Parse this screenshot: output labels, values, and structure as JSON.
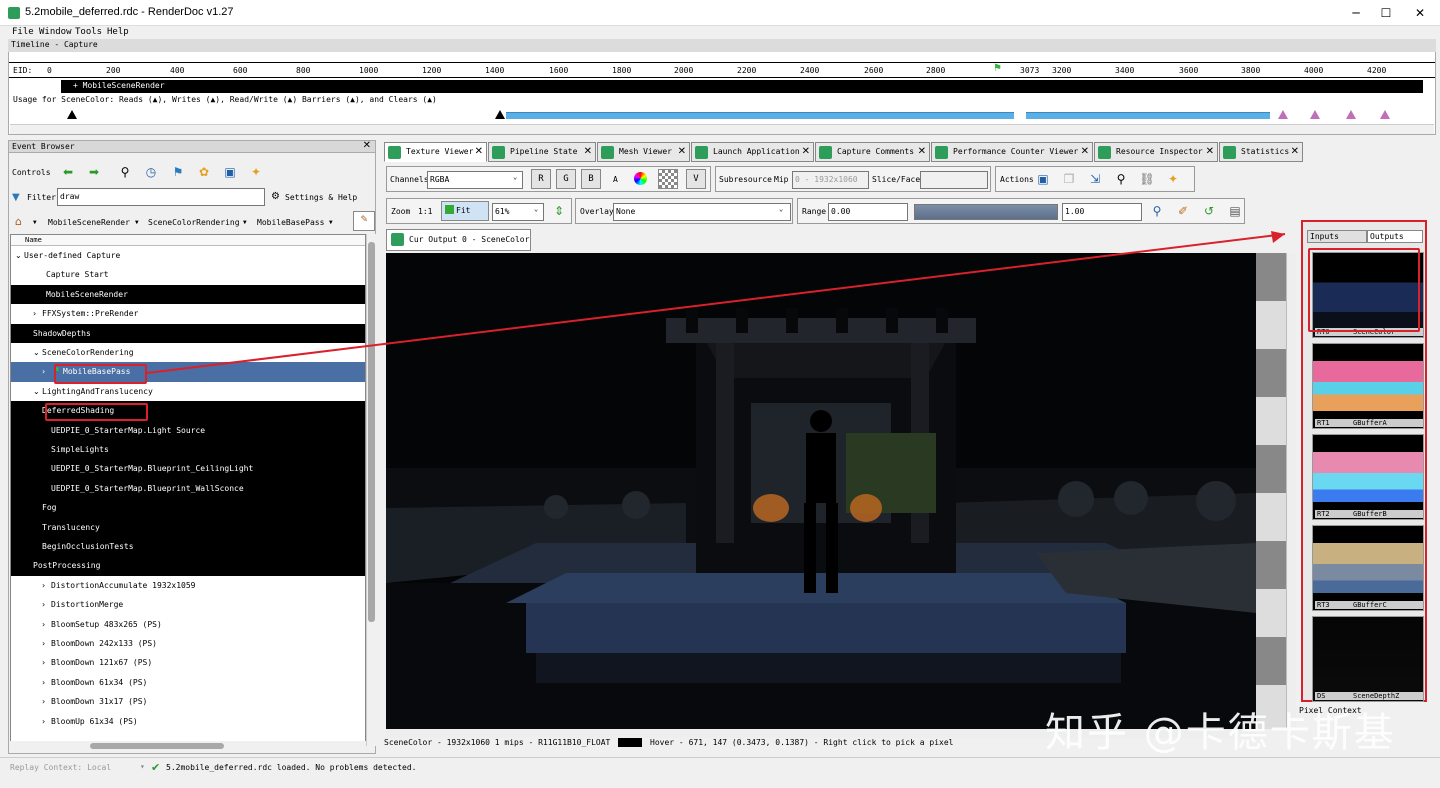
{
  "window": {
    "title": "5.2mobile_deferred.rdc - RenderDoc v1.27",
    "min": "─",
    "max": "☐",
    "close": "✕"
  },
  "menu": [
    "File",
    "Window",
    "Tools",
    "Help"
  ],
  "timeline": {
    "header": "Timeline - Capture",
    "eid_label": "EID:",
    "ticks": [
      "0",
      "200",
      "400",
      "600",
      "800",
      "1000",
      "1200",
      "1400",
      "1600",
      "1800",
      "2000",
      "2200",
      "2400",
      "2600",
      "2800",
      "3073",
      "3200",
      "3400",
      "3600",
      "3800",
      "4000",
      "4200"
    ],
    "marker": "3073",
    "event_label": "+ MobileSceneRender",
    "usage": "Usage for SceneColor: Reads (▲), Writes (▲), Read/Write (▲) Barriers (▲), and Clears (▲)"
  },
  "event_browser": {
    "header": "Event Browser",
    "controls_label": "Controls",
    "filter_label": "Filter",
    "filter_value": "draw",
    "settings_label": "Settings & Help",
    "breadcrumbs": [
      "MobileSceneRender",
      "SceneColorRendering",
      "MobileBasePass"
    ],
    "column": "Name",
    "rows": [
      {
        "indent": 0,
        "arrow": "v",
        "text": "User-defined Capture",
        "style": "normal"
      },
      {
        "indent": 1,
        "arrow": "",
        "text": "Capture Start",
        "style": "normal"
      },
      {
        "indent": 1,
        "arrow": "",
        "text": "MobileSceneRender",
        "style": "dark"
      },
      {
        "indent": 2,
        "arrow": ">",
        "text": "FFXSystem::PreRender",
        "style": "normal"
      },
      {
        "indent": 2,
        "arrow": "",
        "text": "ShadowDepths",
        "style": "dark"
      },
      {
        "indent": 2,
        "arrow": "v",
        "text": "SceneColorRendering",
        "style": "normal"
      },
      {
        "indent": 3,
        "arrow": ">",
        "text": "MobileBasePass",
        "style": "sel"
      },
      {
        "indent": 2,
        "arrow": "v",
        "text": "LightingAndTranslucency",
        "style": "normal"
      },
      {
        "indent": 3,
        "arrow": "",
        "text": "DeferredShading",
        "style": "dark"
      },
      {
        "indent": 4,
        "arrow": "",
        "text": "UEDPIE_0_StarterMap.Light Source",
        "style": "dark"
      },
      {
        "indent": 4,
        "arrow": "",
        "text": "SimpleLights",
        "style": "dark"
      },
      {
        "indent": 4,
        "arrow": "",
        "text": "UEDPIE_0_StarterMap.Blueprint_CeilingLight",
        "style": "dark"
      },
      {
        "indent": 4,
        "arrow": "",
        "text": "UEDPIE_0_StarterMap.Blueprint_WallSconce",
        "style": "dark"
      },
      {
        "indent": 3,
        "arrow": "",
        "text": "Fog",
        "style": "dark"
      },
      {
        "indent": 3,
        "arrow": "",
        "text": "Translucency",
        "style": "dark"
      },
      {
        "indent": 3,
        "arrow": "",
        "text": "BeginOcclusionTests",
        "style": "dark"
      },
      {
        "indent": 2,
        "arrow": "",
        "text": "PostProcessing",
        "style": "dark"
      },
      {
        "indent": 3,
        "arrow": ">",
        "text": "DistortionAccumulate 1932x1059",
        "style": "normal"
      },
      {
        "indent": 3,
        "arrow": ">",
        "text": "DistortionMerge",
        "style": "normal"
      },
      {
        "indent": 3,
        "arrow": ">",
        "text": "BloomSetup 483x265 (PS)",
        "style": "normal"
      },
      {
        "indent": 3,
        "arrow": ">",
        "text": "BloomDown 242x133 (PS)",
        "style": "normal"
      },
      {
        "indent": 3,
        "arrow": ">",
        "text": "BloomDown 121x67 (PS)",
        "style": "normal"
      },
      {
        "indent": 3,
        "arrow": ">",
        "text": "BloomDown 61x34 (PS)",
        "style": "normal"
      },
      {
        "indent": 3,
        "arrow": ">",
        "text": "BloomDown 31x17 (PS)",
        "style": "normal"
      },
      {
        "indent": 3,
        "arrow": ">",
        "text": "BloomUp 61x34 (PS)",
        "style": "normal"
      }
    ]
  },
  "tabs": [
    "Texture Viewer",
    "Pipeline State",
    "Mesh Viewer",
    "Launch Application",
    "Capture Comments",
    "Performance Counter Viewer",
    "Resource Inspector",
    "Statistics"
  ],
  "texture_viewer": {
    "channels_label": "Channels",
    "channels_value": "RGBA",
    "rgba_buttons": [
      "R",
      "G",
      "B",
      "A"
    ],
    "subresource_label": "Subresource",
    "mip_label": "Mip",
    "mip_value": "0 - 1932x1060",
    "slice_label": "Slice/Face",
    "actions_label": "Actions",
    "zoom_label": "Zoom",
    "zoom_ratio": "1:1",
    "fit_label": "Fit",
    "zoom_value": "61%",
    "overlay_label": "Overlay",
    "overlay_value": "None",
    "range_label": "Range",
    "range_min": "0.00",
    "range_max": "1.00",
    "output_tab": "Cur Output 0 - SceneColor",
    "status": "SceneColor - 1932x1060 1 mips - R11G11B10_FLOAT",
    "hover": "Hover -   671,  147 (0.3473, 0.1387)  - Right click to pick a pixel"
  },
  "thumbnails": {
    "tabs": [
      "Inputs",
      "Outputs"
    ],
    "items": [
      {
        "slot": "RT0",
        "name": "SceneColor"
      },
      {
        "slot": "RT1",
        "name": "GBufferA"
      },
      {
        "slot": "RT2",
        "name": "GBufferB"
      },
      {
        "slot": "RT3",
        "name": "GBufferC"
      },
      {
        "slot": "DS",
        "name": "SceneDepthZ"
      }
    ],
    "pixel_context": "Pixel Context"
  },
  "statusbar": {
    "replay": "Replay Context: Local",
    "message": "5.2mobile_deferred.rdc loaded. No problems detected."
  },
  "watermark": "知乎 @卡德卡斯基",
  "colors": {
    "accent_red": "#d8212a",
    "selection": "#4a6fa5",
    "icon_green": "#2e9d5a"
  }
}
